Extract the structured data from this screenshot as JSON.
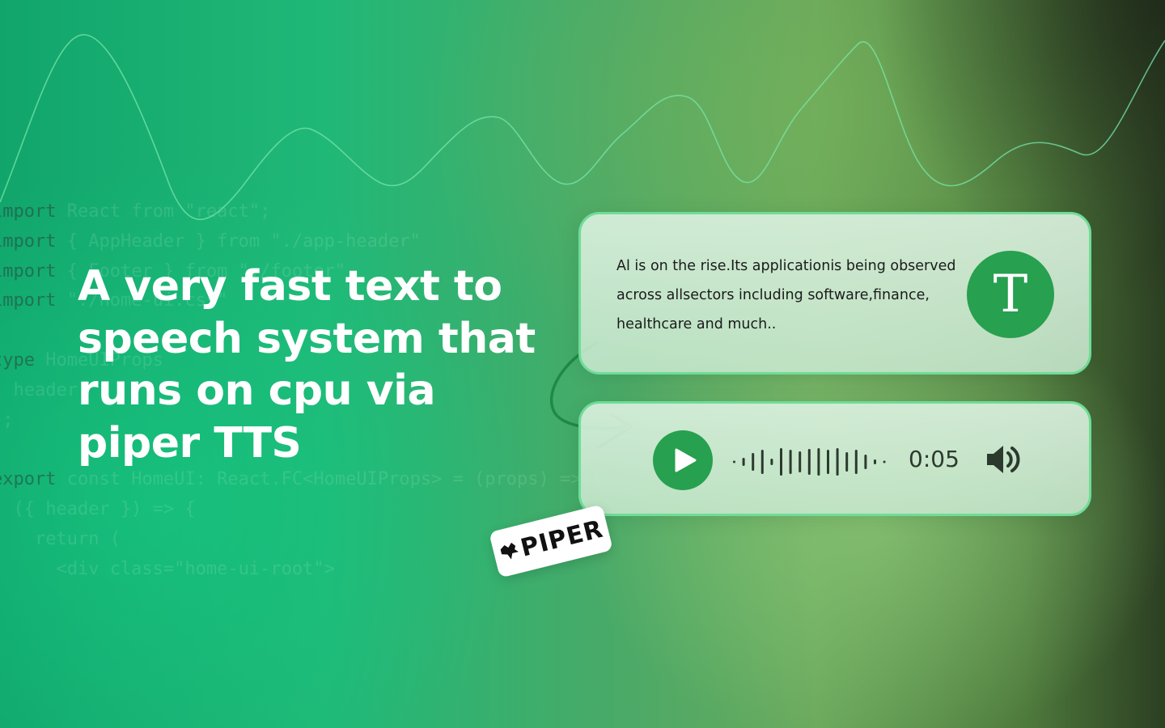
{
  "background": {
    "code_lines": [
      [
        "import",
        " React from \"react\";"
      ],
      [
        "import",
        " { AppHeader } from \"./app-header\""
      ],
      [
        "import",
        " { Footer } from \"./footer\""
      ],
      [
        "import",
        " \"./home-ui.css\""
      ],
      [
        "",
        ""
      ],
      [
        "type",
        " HomeUIProps"
      ],
      [
        "",
        "  header"
      ],
      [
        "",
        "};"
      ],
      [
        "",
        ""
      ],
      [
        "export",
        " const HomeUI: React.FC<HomeUIProps> = (props) => {"
      ],
      [
        "",
        "  ({ header }) => {"
      ],
      [
        "",
        "    return ("
      ],
      [
        "",
        "      <div class=\"home-ui-root\">"
      ]
    ]
  },
  "headline": "A very fast text to speech system that runs on cpu via piper TTS",
  "text_card": {
    "body": "Al is on the rise.Its applicationis being observed across allsectors including software,finance, healthcare and much..",
    "badge_letter": "T",
    "badge_icon": "text-icon"
  },
  "audio_card": {
    "play_icon": "play-icon",
    "duration": "0:05",
    "volume_icon": "volume-icon"
  },
  "brand": {
    "logo_text": "PIPER",
    "logo_icon": "piper-logo-icon"
  },
  "colors": {
    "accent_green": "#27a04f",
    "card_border": "#6fdc97",
    "headline": "#ffffff"
  }
}
